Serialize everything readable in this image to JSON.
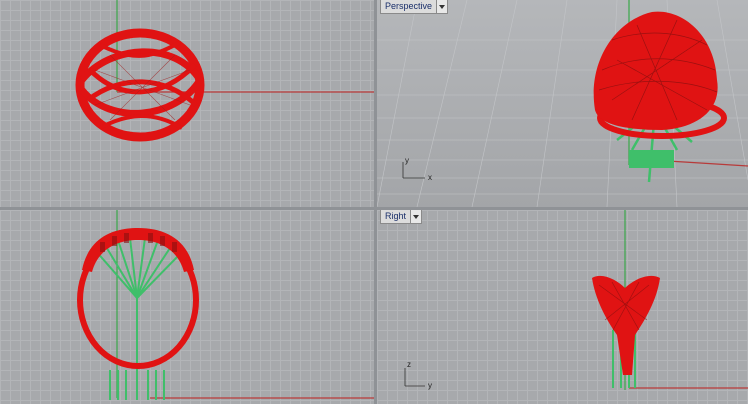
{
  "viewports": {
    "top": {
      "label": ""
    },
    "perspective": {
      "label": "Perspective"
    },
    "front": {
      "label": ""
    },
    "right": {
      "label": "Right"
    }
  },
  "axes": {
    "perspective": {
      "horizontal": "x",
      "vertical": "y"
    },
    "right": {
      "horizontal": "y",
      "vertical": "z"
    }
  },
  "colors": {
    "ring": "#e01313",
    "support": "#3fbf6a",
    "axis_x": "#b83a3a",
    "axis_y": "#3aa84a",
    "grid_bg": "#a7a9ac"
  }
}
